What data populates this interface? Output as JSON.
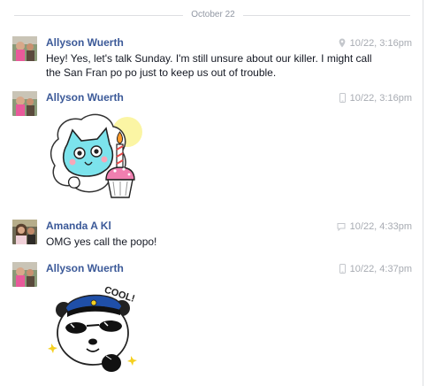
{
  "date_separator": "October 22",
  "messages": [
    {
      "sender": "Allyson Wuerth",
      "time": "10/22, 3:16pm",
      "meta_icon": "location-pin-icon",
      "text": "Hey! Yes, let's talk Sunday. I'm still unsure about our killer. I might call the San Fran po po just to keep us out of trouble."
    },
    {
      "sender": "Allyson Wuerth",
      "time": "10/22, 3:16pm",
      "meta_icon": "mobile-phone-icon",
      "sticker": "birthday-cat-with-cupcake-sticker"
    },
    {
      "sender": "Amanda A Kl",
      "time": "10/22, 4:33pm",
      "meta_icon": "chat-bubble-icon",
      "text": "OMG yes call the popo!"
    },
    {
      "sender": "Allyson Wuerth",
      "time": "10/22, 4:37pm",
      "meta_icon": "mobile-phone-icon",
      "sticker": "cool-police-panda-sticker",
      "sticker_text": "COOL!"
    }
  ],
  "colors": {
    "link": "#3b5998",
    "meta": "#a7abb2",
    "divider": "#dddfe2"
  }
}
